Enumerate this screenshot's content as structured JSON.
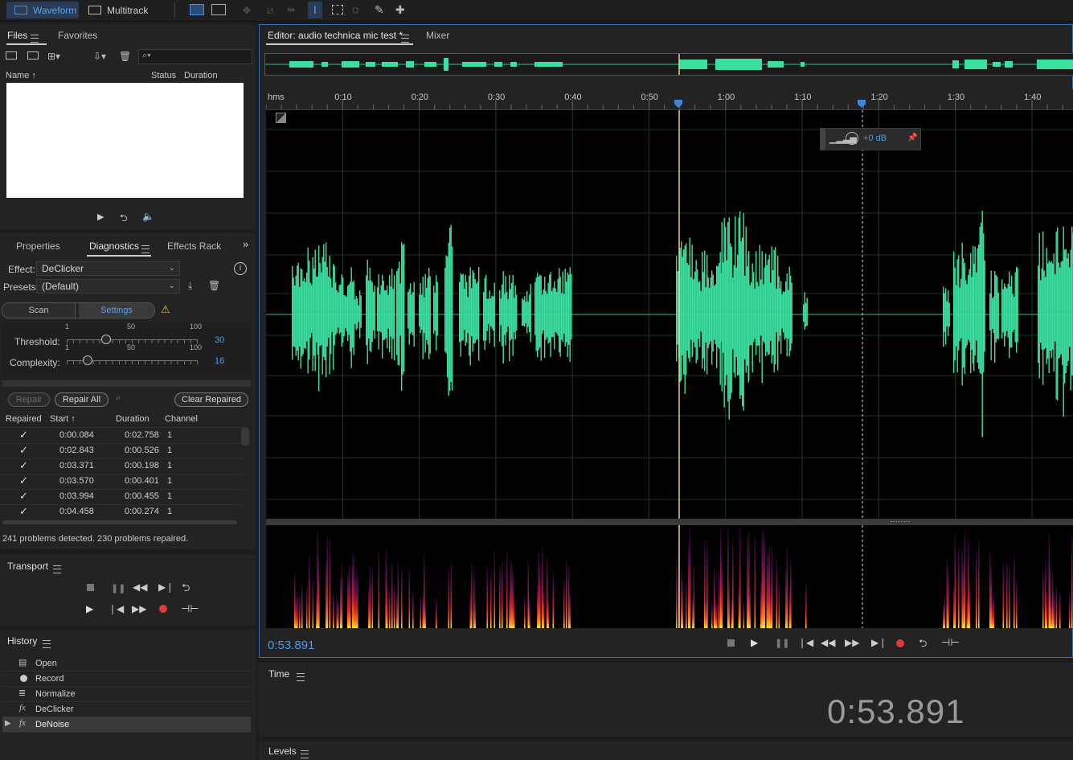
{
  "toolbar": {
    "waveform_label": "Waveform",
    "multitrack_label": "Multitrack"
  },
  "files_panel": {
    "tab_files": "Files",
    "tab_favorites": "Favorites",
    "columns": [
      "Name",
      "Status",
      "Duration"
    ]
  },
  "diagnostics": {
    "tab_properties": "Properties",
    "tab_diagnostics": "Diagnostics",
    "tab_effects_rack": "Effects Rack",
    "effect_label": "Effect:",
    "effect_value": "DeClicker",
    "presets_label": "Presets:",
    "presets_value": "(Default)",
    "scan_label": "Scan",
    "settings_label": "Settings",
    "threshold_label": "Threshold:",
    "threshold_value": "30",
    "complexity_label": "Complexity:",
    "complexity_value": "16",
    "scale": [
      "1",
      "50",
      "100"
    ],
    "repair_label": "Repair",
    "repair_all_label": "Repair All",
    "clear_repaired_label": "Clear Repaired",
    "columns": [
      "Repaired",
      "Start",
      "Duration",
      "Channel"
    ],
    "rows": [
      {
        "start": "0:00.084",
        "duration": "0:02.758",
        "channel": "1"
      },
      {
        "start": "0:02.843",
        "duration": "0:00.526",
        "channel": "1"
      },
      {
        "start": "0:03.371",
        "duration": "0:00.198",
        "channel": "1"
      },
      {
        "start": "0:03.570",
        "duration": "0:00.401",
        "channel": "1"
      },
      {
        "start": "0:03.994",
        "duration": "0:00.455",
        "channel": "1"
      },
      {
        "start": "0:04.458",
        "duration": "0:00.274",
        "channel": "1"
      }
    ],
    "status": "241 problems detected. 230 problems repaired."
  },
  "transport": {
    "title": "Transport"
  },
  "history": {
    "title": "History",
    "items": [
      "Open",
      "Record",
      "Normalize",
      "DeClicker",
      "DeNoise"
    ]
  },
  "editor": {
    "tab_editor": "Editor: audio technica mic test *",
    "tab_mixer": "Mixer",
    "ruler_unit": "hms",
    "ruler_labels": [
      "0:10",
      "0:20",
      "0:30",
      "0:40",
      "0:50",
      "1:00",
      "1:10",
      "1:20",
      "1:30",
      "1:40"
    ],
    "gain_value": "+0 dB",
    "current_time": "0:53.891"
  },
  "time_panel": {
    "title": "Time",
    "value": "0:53.891"
  },
  "levels_panel": {
    "title": "Levels"
  },
  "colors": {
    "accent": "#2d8ceb",
    "waveform": "#3be0a0",
    "record": "#e03a3a"
  }
}
